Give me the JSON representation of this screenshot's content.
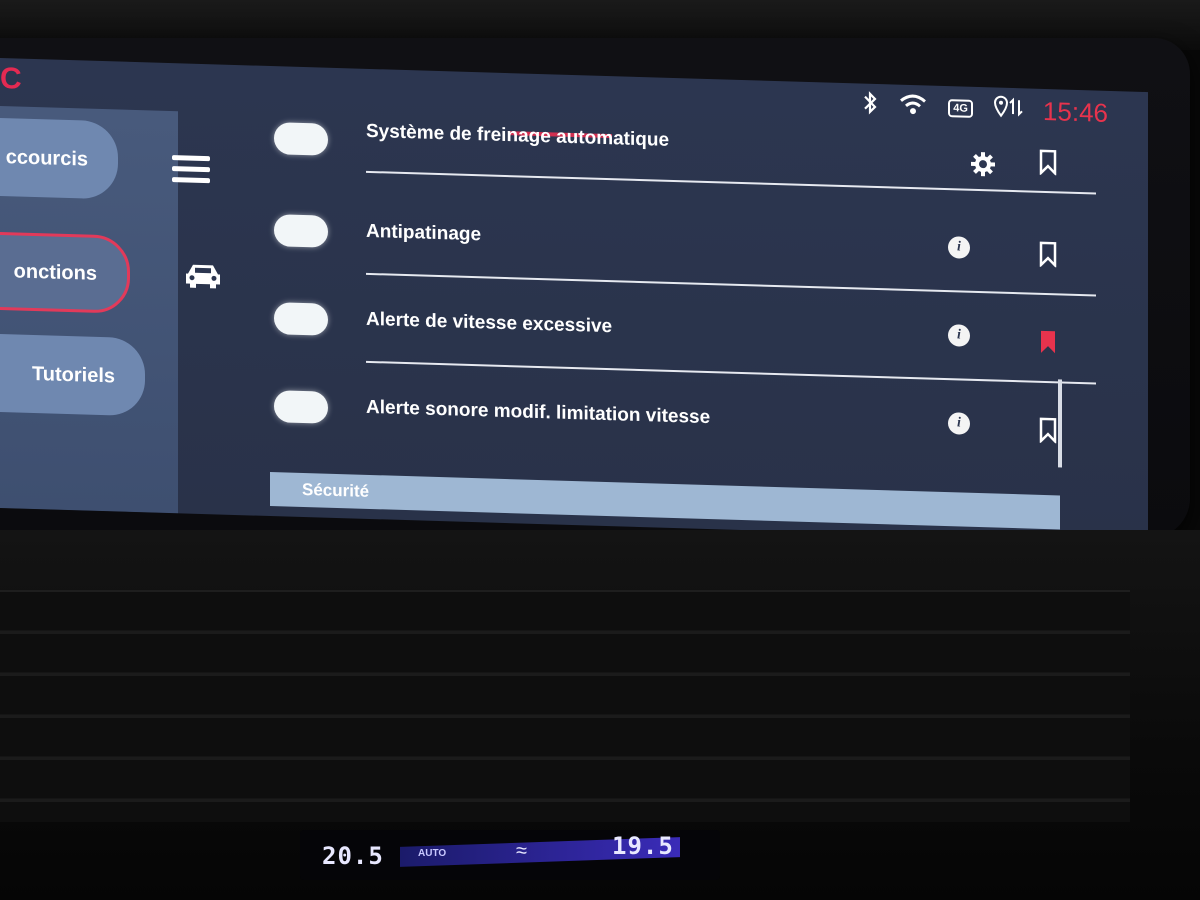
{
  "app": {
    "logo_letter": "C"
  },
  "status_bar": {
    "bluetooth_icon": "bluetooth-icon",
    "wifi_icon": "wifi-icon",
    "network": "4G",
    "location_icon": "location-sync-icon",
    "clock": "15:46",
    "clock_color": "#e8334d"
  },
  "sidebar": {
    "items": [
      {
        "label": "ccourcis",
        "active": false
      },
      {
        "label": "onctions",
        "active": true
      },
      {
        "label": "Tutoriels",
        "active": false
      }
    ],
    "accent_color": "#e23a5a"
  },
  "nav_icons": {
    "menu": "hamburger-menu-icon",
    "vehicle": "car-icon"
  },
  "settings_list": {
    "rows": [
      {
        "label": "Système de freinage automatique",
        "toggle_on": true,
        "action_icon": "gear-icon",
        "bookmarked": false
      },
      {
        "label": "Antipatinage",
        "toggle_on": true,
        "action_icon": "info-icon",
        "bookmarked": false
      },
      {
        "label": "Alerte de vitesse excessive",
        "toggle_on": true,
        "action_icon": "info-icon",
        "bookmarked": true
      },
      {
        "label": "Alerte sonore modif. limitation vitesse",
        "toggle_on": true,
        "action_icon": "info-icon",
        "bookmarked": false
      }
    ],
    "info_glyph": "i"
  },
  "section": {
    "label": "Sécurité"
  },
  "climate": {
    "left_temp": "20.5",
    "mode": "AUTO",
    "right_temp": "19.5"
  }
}
